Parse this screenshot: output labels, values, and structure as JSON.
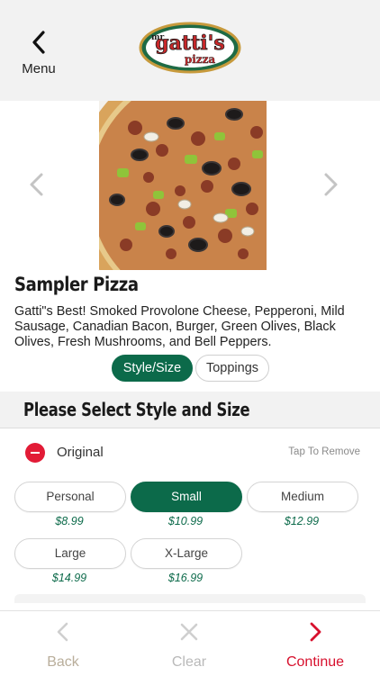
{
  "header": {
    "menu_label": "Menu",
    "logo_text_top": "mr",
    "logo_text_main": "gatti's",
    "logo_text_sub": "pizza"
  },
  "product": {
    "title": "Sampler Pizza",
    "description": "Gatti\"s Best! Smoked Provolone Cheese, Pepperoni, Mild Sausage, Canadian Bacon, Burger, Green Olives, Black Olives, Fresh Mushrooms, and Bell Peppers."
  },
  "tabs": [
    {
      "label": "Style/Size",
      "active": true
    },
    {
      "label": "Toppings",
      "active": false
    }
  ],
  "section": {
    "title": "Please Select Style and Size",
    "style_name": "Original",
    "tap_remove": "Tap To Remove"
  },
  "sizes": [
    {
      "label": "Personal",
      "price": "$8.99",
      "selected": false
    },
    {
      "label": "Small",
      "price": "$10.99",
      "selected": true
    },
    {
      "label": "Medium",
      "price": "$12.99",
      "selected": false
    },
    {
      "label": "Large",
      "price": "$14.99",
      "selected": false
    },
    {
      "label": "X-Large",
      "price": "$16.99",
      "selected": false
    }
  ],
  "footer": {
    "back_label": "Back",
    "clear_label": "Clear",
    "continue_label": "Continue"
  },
  "colors": {
    "accent_green": "#0c6a4a",
    "remove_red": "#e21b36",
    "continue_red": "#d7102d"
  },
  "icons": {
    "menu": "chevron-left-icon",
    "prev": "chevron-left-icon",
    "next": "chevron-right-icon",
    "back": "chevron-left-icon",
    "clear": "x-icon",
    "continue": "chevron-right-icon",
    "remove": "minus-circle-icon"
  }
}
